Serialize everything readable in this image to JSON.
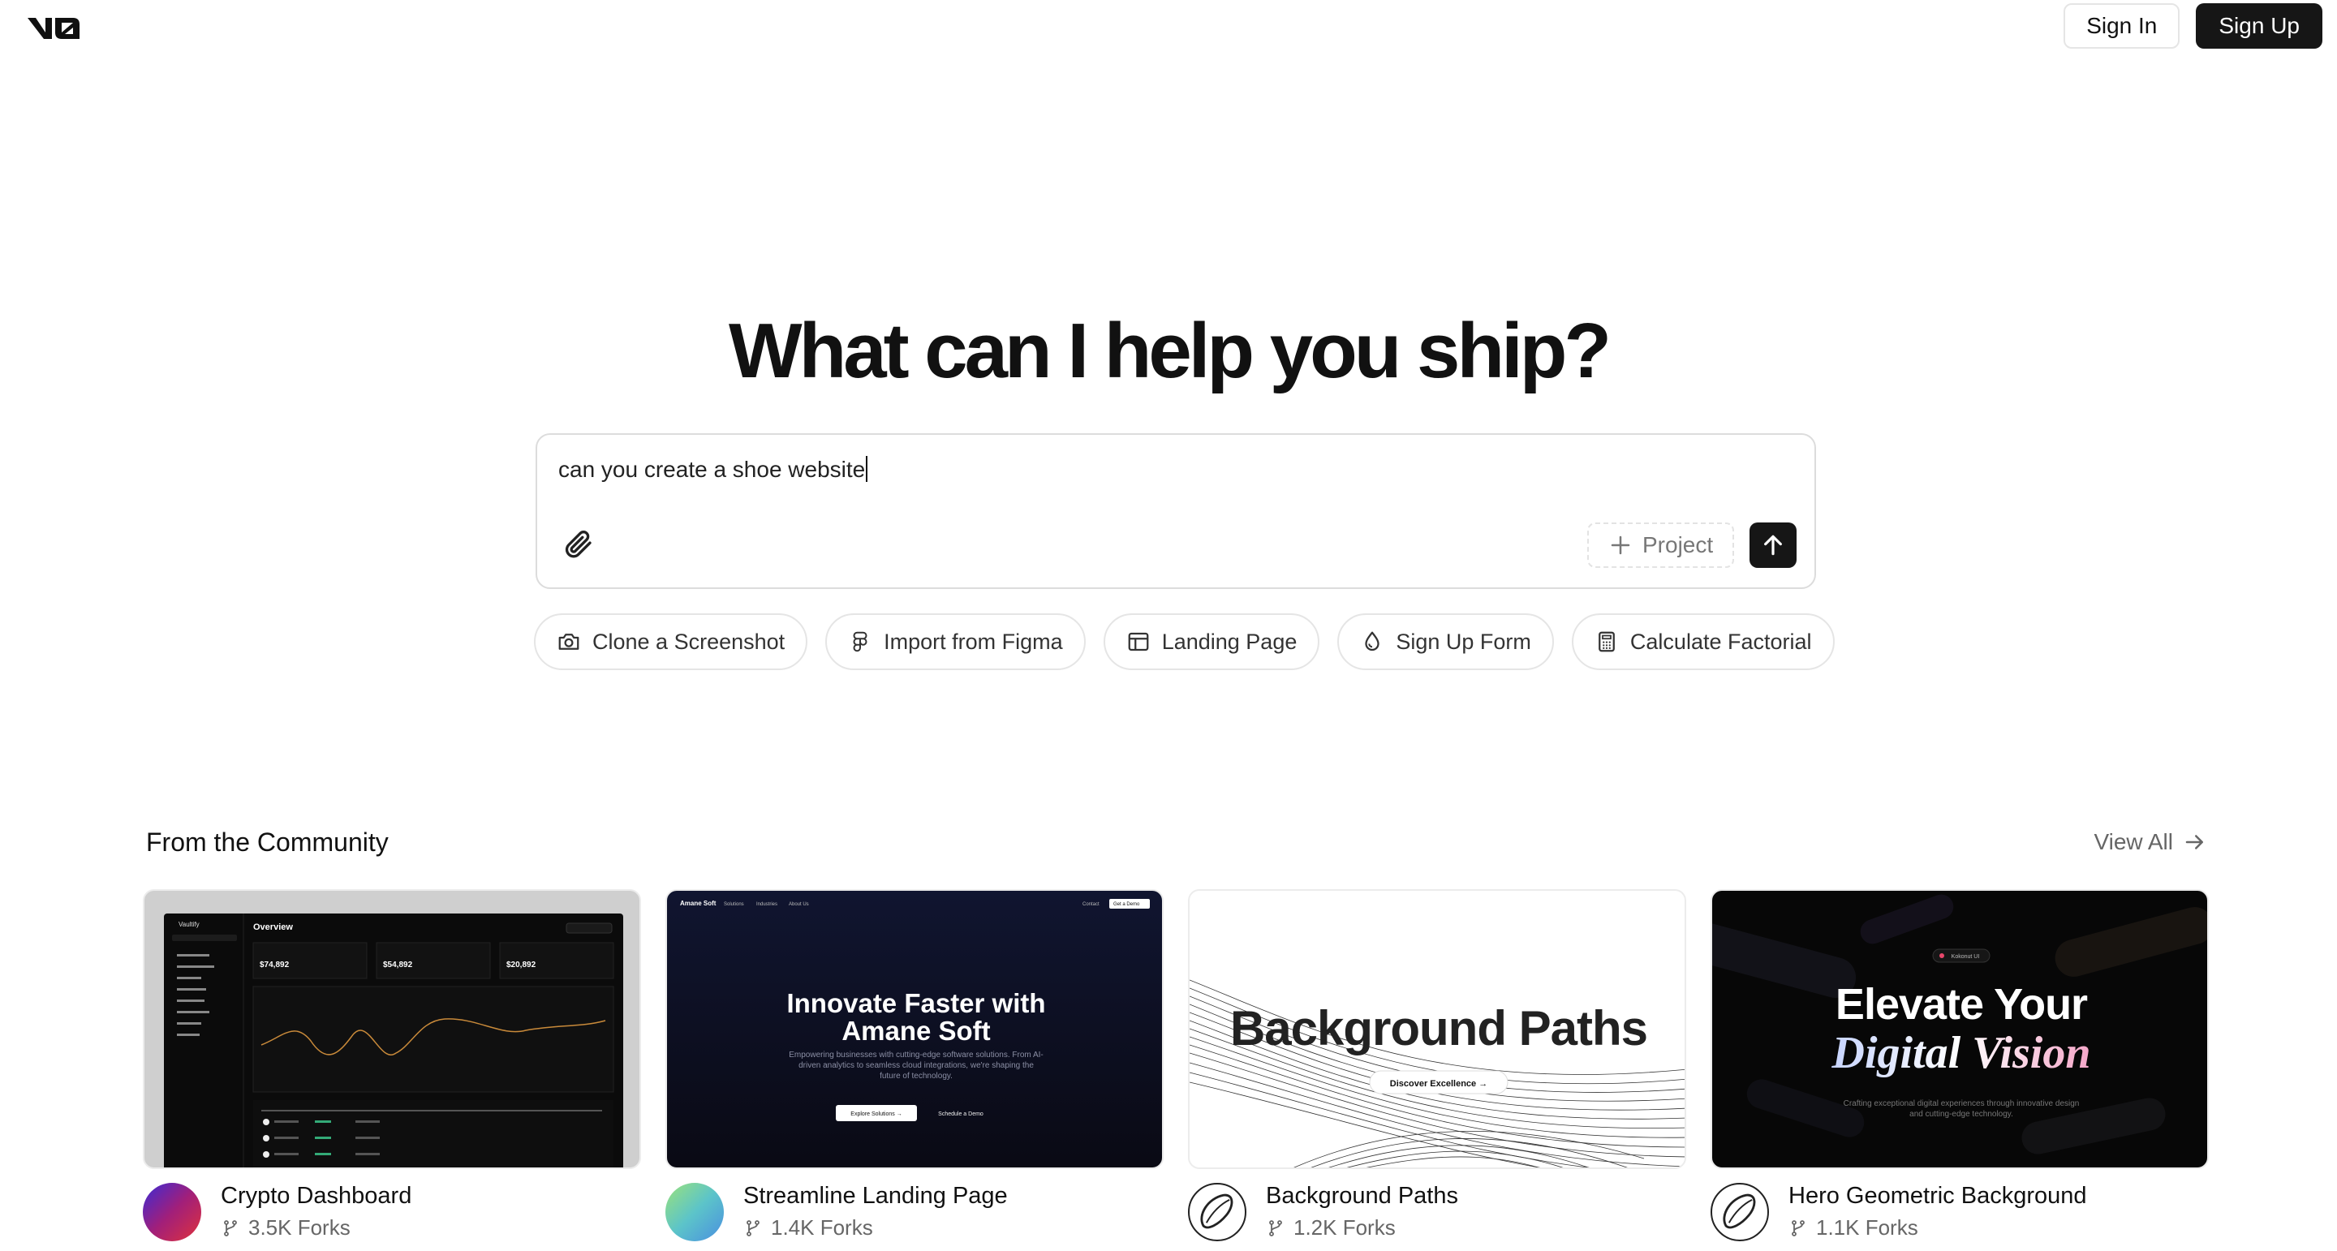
{
  "header": {
    "logo": "v0",
    "sign_in": "Sign In",
    "sign_up": "Sign Up"
  },
  "hero": {
    "title": "What can I help you ship?"
  },
  "prompt": {
    "value": "can you create a shoe website",
    "project_label": "Project"
  },
  "chips": [
    {
      "label": "Clone a Screenshot",
      "icon": "camera-icon"
    },
    {
      "label": "Import from Figma",
      "icon": "figma-icon"
    },
    {
      "label": "Landing Page",
      "icon": "layout-icon"
    },
    {
      "label": "Sign Up Form",
      "icon": "droplet-icon"
    },
    {
      "label": "Calculate Factorial",
      "icon": "calculator-icon"
    }
  ],
  "community": {
    "title": "From the Community",
    "view_all": "View All",
    "cards": [
      {
        "title": "Crypto Dashboard",
        "forks": "3.5K Forks",
        "thumb": {
          "brand": "Vaultify",
          "heading": "Overview",
          "stats": [
            "$74,892",
            "$54,892",
            "$20,892"
          ]
        }
      },
      {
        "title": "Streamline Landing Page",
        "forks": "1.4K Forks",
        "thumb": {
          "brand": "Amane Soft",
          "nav": [
            "Solutions",
            "Industries",
            "About Us"
          ],
          "contact": "Contact",
          "demo": "Get a Demo",
          "headline_1": "Innovate Faster with",
          "headline_2": "Amane Soft",
          "sub": "Empowering businesses with cutting-edge software solutions. From AI-driven analytics to seamless cloud integrations, we're shaping the future of technology.",
          "cta_1": "Explore Solutions →",
          "cta_2": "Schedule a Demo"
        }
      },
      {
        "title": "Background Paths",
        "forks": "1.2K Forks",
        "thumb": {
          "headline": "Background Paths",
          "cta": "Discover Excellence →"
        }
      },
      {
        "title": "Hero Geometric Background",
        "forks": "1.1K Forks",
        "thumb": {
          "badge": "Kokonut UI",
          "headline_1": "Elevate Your",
          "headline_2": "Digital Vision",
          "sub": "Crafting exceptional digital experiences through innovative design and cutting-edge technology."
        }
      }
    ]
  },
  "colors": {
    "dark": "#161616",
    "border": "#e5e5e5",
    "muted": "#666666"
  }
}
